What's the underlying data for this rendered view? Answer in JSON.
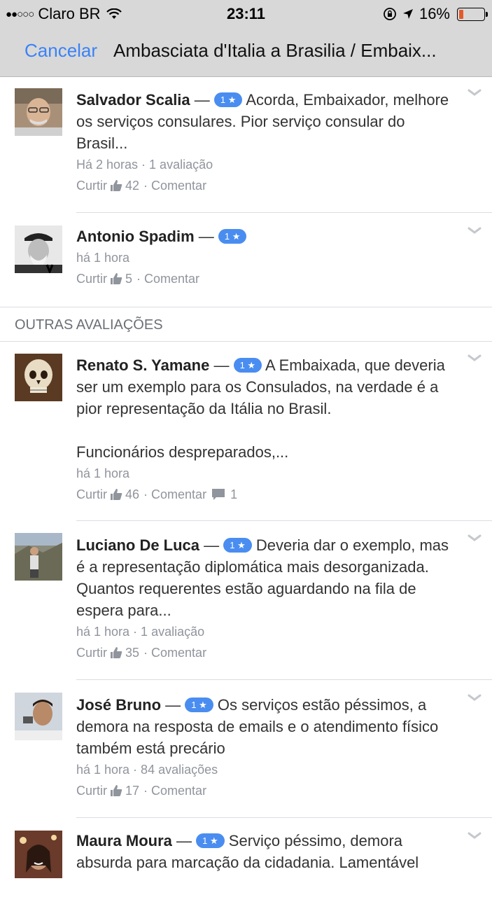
{
  "status_bar": {
    "signal": "●●○○○",
    "carrier": "Claro BR",
    "time": "23:11",
    "battery": "16%"
  },
  "nav": {
    "cancel_label": "Cancelar",
    "title": "Ambasciata d'Italia a Brasilia / Embaix..."
  },
  "reviews_top": [
    {
      "name": "Salvador Scalia",
      "rating": "1 ★",
      "text": "Acorda, Embaixador, melhore os serviços consulares. Pior serviço consular do Brasil...",
      "meta": "Há 2 horas · 1 avaliação",
      "like_label": "Curtir",
      "likes": "42",
      "comment_label": "· Comentar"
    },
    {
      "name": "Antonio Spadim",
      "rating": "1 ★",
      "text": "",
      "meta": "há 1 hora",
      "like_label": "Curtir",
      "likes": "5",
      "comment_label": "· Comentar"
    }
  ],
  "section_title": "OUTRAS AVALIAÇÕES",
  "reviews_other": [
    {
      "name": "Renato S. Yamane",
      "rating": "1 ★",
      "text": "A Embaixada, que deveria ser um exemplo para os Consulados, na verdade é a pior representação da Itália no Brasil.",
      "text2": "Funcionários despreparados,...",
      "meta": "há 1 hora",
      "like_label": "Curtir",
      "likes": "46",
      "comment_label": "· Comentar",
      "comments": "1"
    },
    {
      "name": "Luciano De Luca",
      "rating": "1 ★",
      "text": "Deveria dar o exemplo, mas é a representação diplomática mais desorganizada. Quantos requerentes estão aguardando na fila de espera para...",
      "meta": "há 1 hora · 1 avaliação",
      "like_label": "Curtir",
      "likes": "35",
      "comment_label": "· Comentar"
    },
    {
      "name": "José Bruno",
      "rating": "1 ★",
      "text": "Os serviços estão péssimos, a demora na resposta de emails e o atendimento físico também está precário",
      "meta": "há 1 hora · 84 avaliações",
      "like_label": "Curtir",
      "likes": "17",
      "comment_label": "· Comentar"
    },
    {
      "name": "Maura Moura",
      "rating": "1 ★",
      "text": "Serviço péssimo, demora absurda para marcação da cidadania. Lamentável"
    }
  ],
  "colors": {
    "accent": "#3b82f6",
    "badge": "#4a8df0",
    "muted": "#90949c"
  }
}
